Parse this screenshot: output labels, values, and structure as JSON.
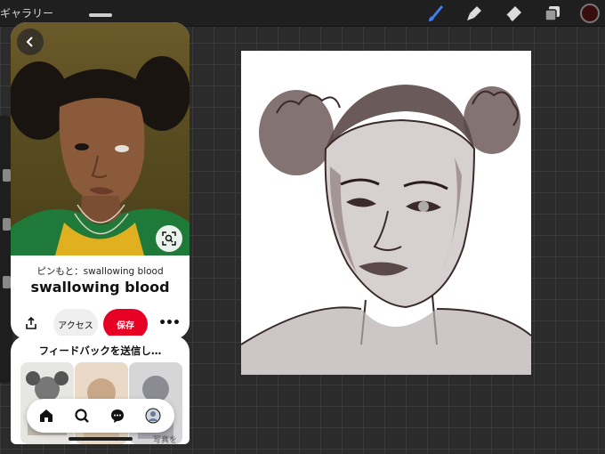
{
  "procreate": {
    "gallery_label": "ギャラリー",
    "brush_color": "#3a0d0d"
  },
  "pinterest": {
    "source_prefix": "ピンもと：",
    "source_name": "swallowing blood",
    "title": "swallowing blood",
    "access_label": "アクセス",
    "save_label": "保存",
    "more_label": "•••",
    "feedback_title": "フィードバックを送信し…",
    "thumb_caption": "写真を",
    "accent_color": "#e60023"
  }
}
